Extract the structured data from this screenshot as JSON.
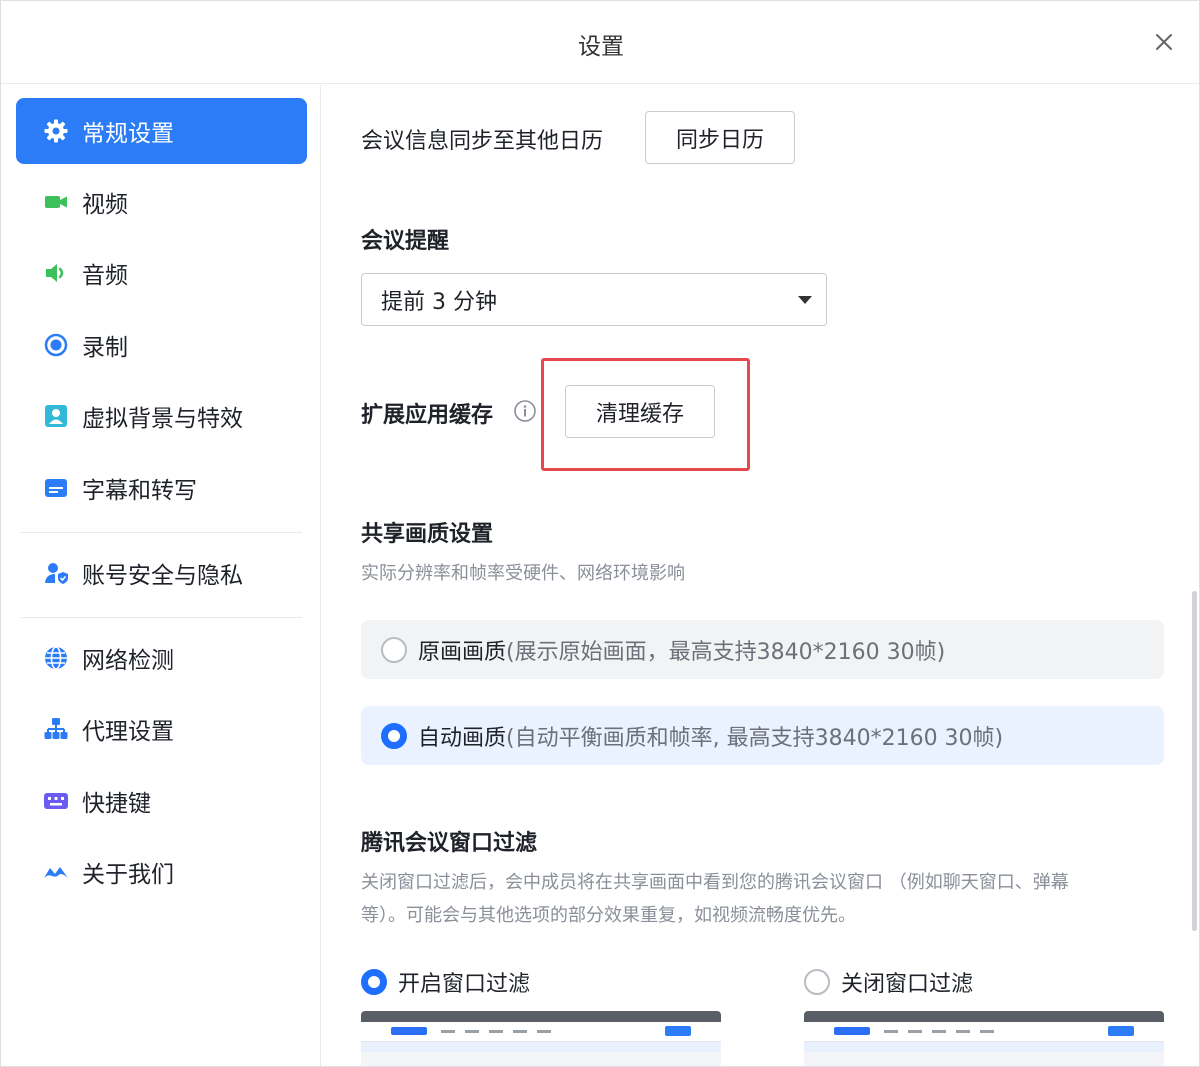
{
  "window": {
    "title": "设置"
  },
  "sidebar": {
    "items": [
      {
        "label": "常规设置",
        "icon": "gear-icon",
        "active": true
      },
      {
        "label": "视频",
        "icon": "camera-icon"
      },
      {
        "label": "音频",
        "icon": "speaker-icon"
      },
      {
        "label": "录制",
        "icon": "record-icon"
      },
      {
        "label": "虚拟背景与特效",
        "icon": "portrait-icon"
      },
      {
        "label": "字幕和转写",
        "icon": "caption-icon"
      },
      {
        "label": "账号安全与隐私",
        "icon": "user-shield-icon"
      },
      {
        "label": "网络检测",
        "icon": "globe-icon"
      },
      {
        "label": "代理设置",
        "icon": "network-tree-icon"
      },
      {
        "label": "快捷键",
        "icon": "keyboard-icon"
      },
      {
        "label": "关于我们",
        "icon": "logo-icon"
      }
    ]
  },
  "content": {
    "calendar_sync": {
      "label": "会议信息同步至其他日历",
      "button": "同步日历"
    },
    "reminder": {
      "title": "会议提醒",
      "selected": "提前 3 分钟"
    },
    "cache": {
      "label": "扩展应用缓存",
      "button": "清理缓存"
    },
    "share_quality": {
      "title": "共享画质设置",
      "desc": "实际分辨率和帧率受硬件、网络环境影响",
      "options": [
        {
          "main": "原画画质",
          "sub": "(展示原始画面，最高支持3840*2160 30帧)",
          "selected": false
        },
        {
          "main": "自动画质",
          "sub": "(自动平衡画质和帧率, 最高支持3840*2160 30帧)",
          "selected": true
        }
      ]
    },
    "window_filter": {
      "title": "腾讯会议窗口过滤",
      "desc_line1": "关闭窗口过滤后，会中成员将在共享画面中看到您的腾讯会议窗口 （例如聊天窗口、弹幕",
      "desc_line2": "等）。可能会与其他选项的部分效果重复，如视频流畅度优先。",
      "options": [
        {
          "label": "开启窗口过滤",
          "selected": true
        },
        {
          "label": "关闭窗口过滤",
          "selected": false
        }
      ]
    }
  },
  "colors": {
    "accent": "#2b7cf6",
    "highlight": "#e5484d",
    "selected_card": "#eaf2ff",
    "card": "#f2f3f5"
  }
}
